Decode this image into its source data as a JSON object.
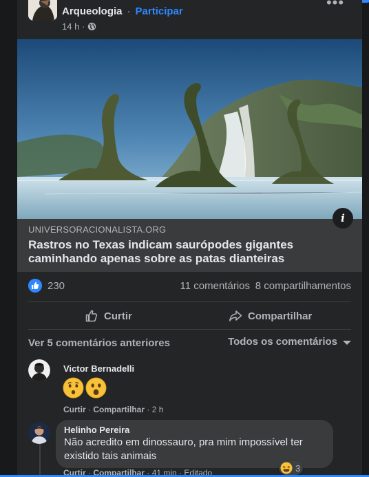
{
  "post": {
    "group_name": "Arqueologia",
    "separator": "·",
    "join_label": "Participar",
    "time": "14 h ·",
    "more_icon": "more-icon",
    "more_glyph": "•••"
  },
  "link_preview": {
    "domain": "UNIVERSORACIONALISTA.ORG",
    "title": "Rastros no Texas indicam saurópodes gigantes caminhando apenas sobre as patas dianteiras",
    "info_glyph": "i"
  },
  "stats": {
    "reaction_count": "230",
    "comments": "11 comentários",
    "shares": "8 compartilhamentos"
  },
  "actions": {
    "like_label": "Curtir",
    "share_label": "Compartilhar"
  },
  "comments_bar": {
    "view_previous": "Ver 5 comentários anteriores",
    "sort_label": "Todos os comentários"
  },
  "comments": [
    {
      "author": "Victor Bernadelli",
      "emojis": [
        "hushed-face-emoji",
        "astonished-face-emoji"
      ],
      "like": "Curtir",
      "reply": "Compartilhar",
      "time": "2 h"
    },
    {
      "author": "Helinho Pereira",
      "text": "Não acredito em dinossauro, pra mim impossível ter existido tais animais",
      "reaction_count": "3",
      "like": "Curtir",
      "reply": "Compartilhar",
      "time": "41 min",
      "edited": "Editado"
    }
  ],
  "colors": {
    "background": "#18191a",
    "card": "#242526",
    "accent": "#2d88ff",
    "text_primary": "#e4e6eb",
    "text_secondary": "#b0b3b8"
  }
}
